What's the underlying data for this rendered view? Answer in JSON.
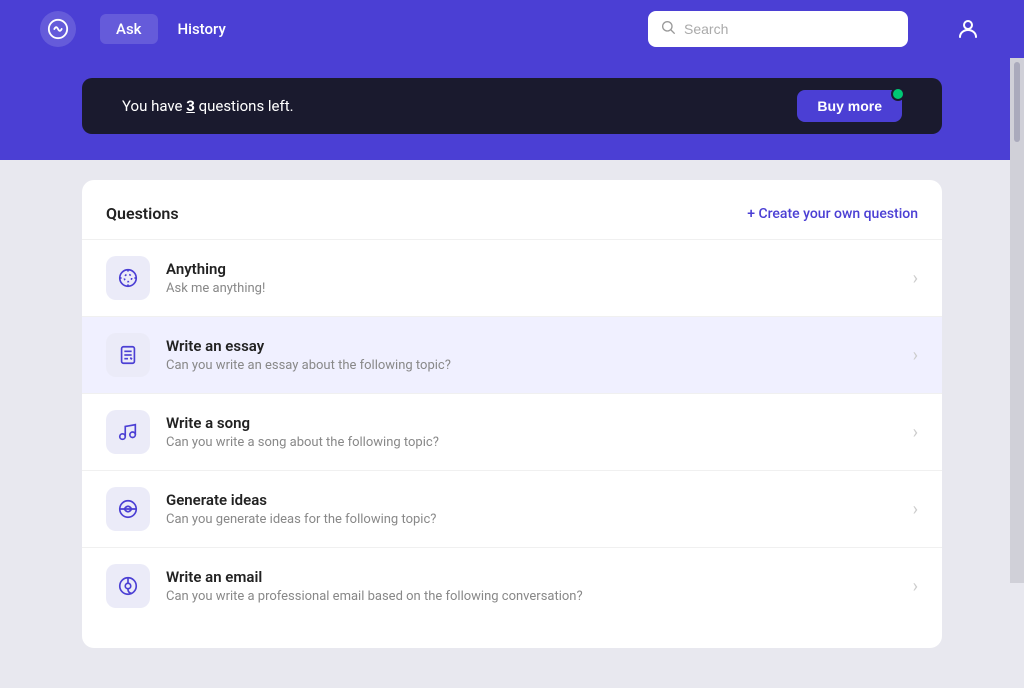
{
  "header": {
    "nav": [
      {
        "label": "Ask",
        "active": true
      },
      {
        "label": "History",
        "active": false
      }
    ],
    "search_placeholder": "Search",
    "user_icon_label": "user"
  },
  "banner": {
    "text_prefix": "You have ",
    "count": "3",
    "text_suffix": " questions left.",
    "button_label": "Buy more"
  },
  "questions_section": {
    "title": "Questions",
    "create_link": "+ Create your own question",
    "items": [
      {
        "title": "Anything",
        "subtitle": "Ask me anything!",
        "icon": "anything",
        "highlighted": false
      },
      {
        "title": "Write an essay",
        "subtitle": "Can you write an essay about the following topic?",
        "icon": "essay",
        "highlighted": true
      },
      {
        "title": "Write a song",
        "subtitle": "Can you write a song about the following topic?",
        "icon": "song",
        "highlighted": false
      },
      {
        "title": "Generate ideas",
        "subtitle": "Can you generate ideas for the following topic?",
        "icon": "ideas",
        "highlighted": false
      },
      {
        "title": "Write an email",
        "subtitle": "Can you write a professional email based on the following conversation?",
        "icon": "email",
        "highlighted": false
      }
    ]
  }
}
